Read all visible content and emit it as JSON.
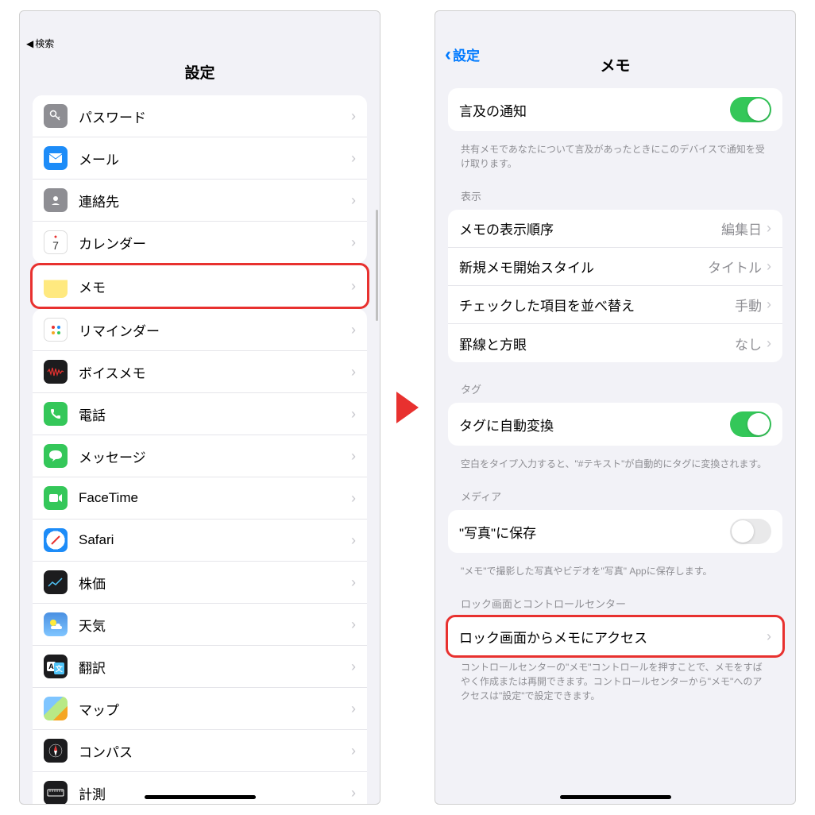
{
  "left": {
    "breadcrumb_back": "検索",
    "title": "設定",
    "items": [
      {
        "k": "password",
        "label": "パスワード"
      },
      {
        "k": "mail",
        "label": "メール"
      },
      {
        "k": "contacts",
        "label": "連絡先"
      },
      {
        "k": "calendar",
        "label": "カレンダー"
      },
      {
        "k": "notes",
        "label": "メモ",
        "highlight": true
      },
      {
        "k": "reminders",
        "label": "リマインダー"
      },
      {
        "k": "voicememo",
        "label": "ボイスメモ"
      },
      {
        "k": "phone",
        "label": "電話"
      },
      {
        "k": "messages",
        "label": "メッセージ"
      },
      {
        "k": "facetime",
        "label": "FaceTime"
      },
      {
        "k": "safari",
        "label": "Safari"
      },
      {
        "k": "stocks",
        "label": "株価"
      },
      {
        "k": "weather",
        "label": "天気"
      },
      {
        "k": "translate",
        "label": "翻訳"
      },
      {
        "k": "maps",
        "label": "マップ"
      },
      {
        "k": "compass",
        "label": "コンパス"
      },
      {
        "k": "measure",
        "label": "計測"
      }
    ]
  },
  "right": {
    "back": "設定",
    "title": "メモ",
    "mention": {
      "label": "言及の通知",
      "footer": "共有メモであなたについて言及があったときにこのデバイスで通知を受け取ります。"
    },
    "display": {
      "header": "表示",
      "sort": {
        "label": "メモの表示順序",
        "value": "編集日"
      },
      "style": {
        "label": "新規メモ開始スタイル",
        "value": "タイトル"
      },
      "check": {
        "label": "チェックした項目を並べ替え",
        "value": "手動"
      },
      "lines": {
        "label": "罫線と方眼",
        "value": "なし"
      }
    },
    "tag": {
      "header": "タグ",
      "label": "タグに自動変換",
      "footer": "空白をタイプ入力すると、\"#テキスト\"が自動的にタグに変換されます。"
    },
    "media": {
      "header": "メディア",
      "label": "\"写真\"に保存",
      "footer": "\"メモ\"で撮影した写真やビデオを\"写真\" Appに保存します。"
    },
    "lock": {
      "header": "ロック画面とコントロールセンター",
      "label": "ロック画面からメモにアクセス",
      "footer": "コントロールセンターの\"メモ\"コントロールを押すことで、メモをすばやく作成または再開できます。コントロールセンターから\"メモ\"へのアクセスは\"設定\"で設定できます。"
    }
  }
}
